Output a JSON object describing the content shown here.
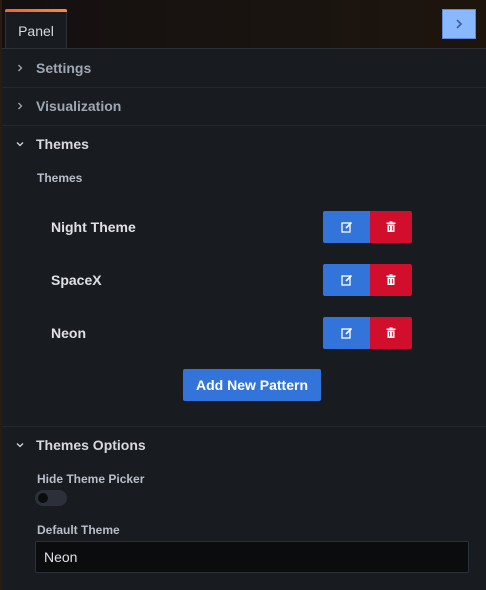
{
  "tabs": [
    {
      "label": "Panel"
    }
  ],
  "sections": {
    "settings": {
      "title": "Settings",
      "expanded": false
    },
    "visualization": {
      "title": "Visualization",
      "expanded": false
    },
    "themes": {
      "title": "Themes",
      "expanded": true,
      "field_label": "Themes"
    },
    "themes_options": {
      "title": "Themes Options",
      "expanded": true
    }
  },
  "themes": [
    {
      "name": "Night Theme"
    },
    {
      "name": "SpaceX"
    },
    {
      "name": "Neon"
    }
  ],
  "add_button": "Add New Pattern",
  "hide_theme_picker": {
    "label": "Hide Theme Picker",
    "enabled": false
  },
  "default_theme": {
    "label": "Default Theme",
    "value": "Neon"
  },
  "icons": {
    "collapse": "chevron-right-icon",
    "edit": "edit-icon",
    "delete": "trash-icon",
    "collapsed_section": "chevron-right-icon",
    "expanded_section": "chevron-down-icon"
  },
  "colors": {
    "primary": "#3274d9",
    "destructive": "#d10e2c",
    "tab_accent": "#f55f3e",
    "collapse_button": "#8ab8ff"
  }
}
